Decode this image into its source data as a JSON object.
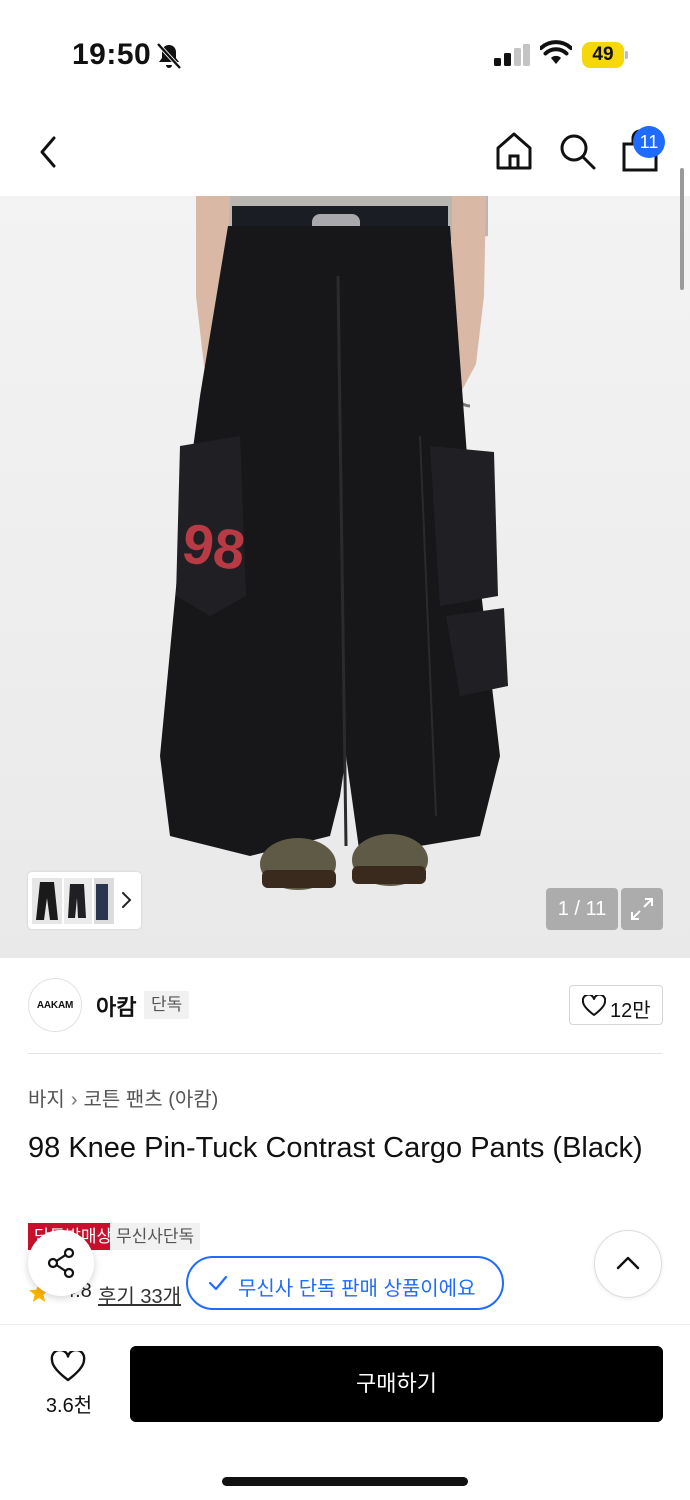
{
  "status_bar": {
    "time": "19:50",
    "battery": "49",
    "icons": [
      "bell-off-icon",
      "signal-icon",
      "wifi-icon",
      "battery-icon"
    ]
  },
  "nav": {
    "icons": [
      "back-icon",
      "home-icon",
      "search-icon",
      "shopping-bag-icon"
    ],
    "cart_count": "11"
  },
  "gallery": {
    "counter": "1 / 11",
    "expand_icon": "expand-icon"
  },
  "brand": {
    "logo_text": "AAKAM",
    "name": "아캄",
    "tag": "단독",
    "like_count": "12만"
  },
  "breadcrumb": {
    "items": [
      "바지",
      "코튼 팬츠 (아캄)"
    ]
  },
  "product": {
    "title": "98 Knee Pin-Tuck Contrast Cargo Pants (Black)",
    "badges": [
      "단독발매상",
      "무신사단독"
    ],
    "rating": "4.8",
    "reviews": "후기 33개"
  },
  "toast": {
    "message": "무신사 단독 판매 상품이에요"
  },
  "bottom": {
    "wish_count": "3.6천",
    "buy_label": "구매하기"
  },
  "colors": {
    "accent": "#1f6bff",
    "badge_red": "#c8102e",
    "battery": "#f5d70a"
  }
}
